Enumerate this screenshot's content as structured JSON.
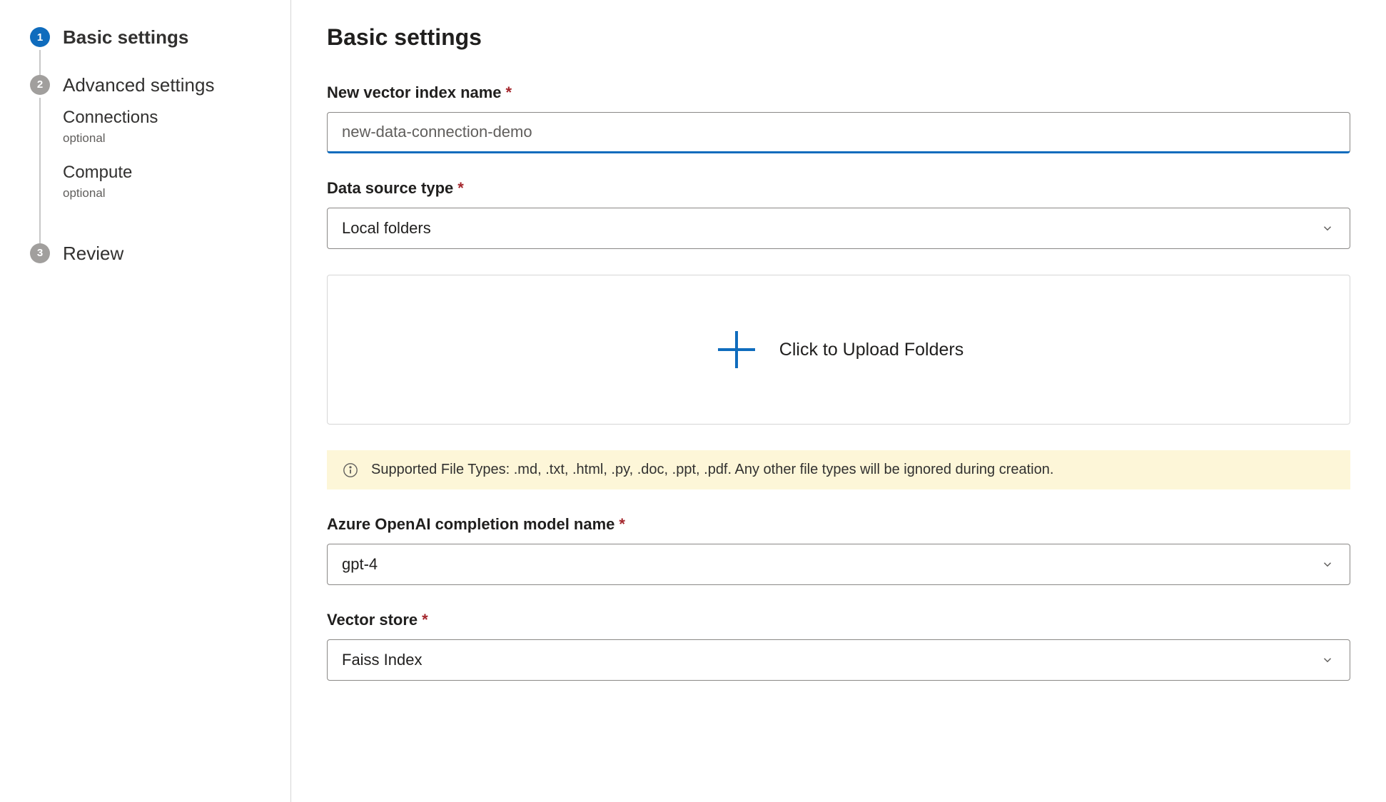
{
  "stepper": {
    "steps": [
      {
        "number": "1",
        "label": "Basic settings",
        "active": true,
        "substeps": []
      },
      {
        "number": "2",
        "label": "Advanced settings",
        "active": false,
        "substeps": [
          {
            "label": "Connections",
            "hint": "optional"
          },
          {
            "label": "Compute",
            "hint": "optional"
          }
        ]
      },
      {
        "number": "3",
        "label": "Review",
        "active": false,
        "substeps": []
      }
    ]
  },
  "main": {
    "title": "Basic settings",
    "fields": {
      "index_name": {
        "label": "New vector index name",
        "required": true,
        "placeholder": "new-data-connection-demo",
        "value": ""
      },
      "data_source": {
        "label": "Data source type",
        "required": true,
        "value": "Local folders"
      },
      "upload": {
        "label": "Click to Upload Folders"
      },
      "info": {
        "text": "Supported File Types: .md, .txt, .html, .py, .doc, .ppt, .pdf. Any other file types will be ignored during creation."
      },
      "model_name": {
        "label": "Azure OpenAI completion model name",
        "required": true,
        "value": "gpt-4"
      },
      "vector_store": {
        "label": "Vector store",
        "required": true,
        "value": "Faiss Index"
      }
    },
    "required_marker": "*"
  }
}
